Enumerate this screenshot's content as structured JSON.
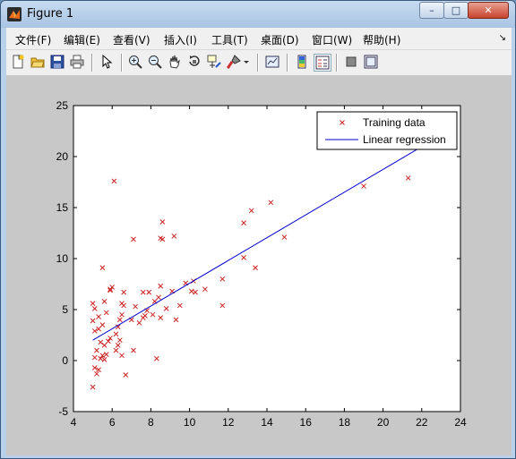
{
  "window": {
    "title": "Figure 1",
    "minimize_label": "–",
    "maximize_label": "□",
    "close_label": "✕"
  },
  "menu": {
    "items": [
      "文件(F)",
      "编辑(E)",
      "查看(V)",
      "插入(I)",
      "工具(T)",
      "桌面(D)",
      "窗口(W)",
      "帮助(H)"
    ],
    "overflow": "↘"
  },
  "toolbar": {
    "icons": [
      "new-figure-icon",
      "open-file-icon",
      "save-icon",
      "print-icon",
      "pointer-icon",
      "zoom-in-icon",
      "zoom-out-icon",
      "pan-icon",
      "rotate-3d-icon",
      "data-cursor-icon",
      "brush-icon",
      "link-plot-icon",
      "colorbar-icon",
      "legend-icon",
      "hide-plot-tools-icon",
      "show-plot-tools-icon"
    ]
  },
  "chart_data": {
    "type": "scatter",
    "xlim": [
      4,
      24
    ],
    "ylim": [
      -5,
      25
    ],
    "xticks": [
      4,
      6,
      8,
      10,
      12,
      14,
      16,
      18,
      20,
      22,
      24
    ],
    "yticks": [
      -5,
      0,
      5,
      10,
      15,
      20,
      25
    ],
    "grid": false,
    "legend_placement": "top-right",
    "legend": {
      "scatter_label": "Training data",
      "line_label": "Linear regression"
    },
    "colors": {
      "scatter": "#cc2222",
      "line": "#0000cc"
    },
    "series": [
      {
        "name": "Training data",
        "marker": "x",
        "points": [
          [
            5.0,
            -2.6
          ],
          [
            5.1,
            -0.7
          ],
          [
            5.2,
            -1.3
          ],
          [
            5.3,
            -0.9
          ],
          [
            5.4,
            0.2
          ],
          [
            5.1,
            0.3
          ],
          [
            5.2,
            1.0
          ],
          [
            5.5,
            0.5
          ],
          [
            5.6,
            0.1
          ],
          [
            5.7,
            0.6
          ],
          [
            5.4,
            1.8
          ],
          [
            5.6,
            1.5
          ],
          [
            5.8,
            1.9
          ],
          [
            5.9,
            2.2
          ],
          [
            5.1,
            2.9
          ],
          [
            5.3,
            3.1
          ],
          [
            5.5,
            3.5
          ],
          [
            5.0,
            3.9
          ],
          [
            5.3,
            4.3
          ],
          [
            5.7,
            4.7
          ],
          [
            5.1,
            5.1
          ],
          [
            5.0,
            5.6
          ],
          [
            5.6,
            5.8
          ],
          [
            5.9,
            7.0
          ],
          [
            5.9,
            6.9
          ],
          [
            6.0,
            7.2
          ],
          [
            5.5,
            9.1
          ],
          [
            6.1,
            17.6
          ],
          [
            6.2,
            1.0
          ],
          [
            6.3,
            1.5
          ],
          [
            6.2,
            2.6
          ],
          [
            6.4,
            2.0
          ],
          [
            6.5,
            0.5
          ],
          [
            6.3,
            3.3
          ],
          [
            6.4,
            4.0
          ],
          [
            6.5,
            4.5
          ],
          [
            6.6,
            5.4
          ],
          [
            6.5,
            5.6
          ],
          [
            6.6,
            6.7
          ],
          [
            6.7,
            -1.4
          ],
          [
            7.0,
            4.0
          ],
          [
            7.1,
            1.0
          ],
          [
            7.2,
            5.3
          ],
          [
            7.4,
            3.7
          ],
          [
            7.6,
            4.2
          ],
          [
            7.7,
            4.4
          ],
          [
            7.6,
            6.7
          ],
          [
            7.8,
            4.9
          ],
          [
            7.9,
            6.7
          ],
          [
            7.1,
            11.9
          ],
          [
            8.1,
            4.5
          ],
          [
            8.2,
            5.8
          ],
          [
            8.4,
            6.2
          ],
          [
            8.5,
            7.3
          ],
          [
            8.3,
            0.2
          ],
          [
            8.5,
            4.2
          ],
          [
            8.6,
            11.9
          ],
          [
            8.5,
            12.0
          ],
          [
            8.6,
            13.6
          ],
          [
            8.8,
            5.1
          ],
          [
            9.1,
            6.8
          ],
          [
            9.3,
            4.0
          ],
          [
            9.2,
            12.2
          ],
          [
            9.5,
            5.4
          ],
          [
            9.8,
            7.6
          ],
          [
            10.1,
            6.8
          ],
          [
            10.2,
            7.8
          ],
          [
            10.3,
            6.7
          ],
          [
            10.8,
            7.0
          ],
          [
            11.7,
            8.0
          ],
          [
            11.7,
            5.4
          ],
          [
            12.8,
            10.1
          ],
          [
            12.8,
            13.5
          ],
          [
            13.2,
            14.7
          ],
          [
            13.4,
            9.1
          ],
          [
            14.2,
            15.5
          ],
          [
            14.9,
            12.1
          ],
          [
            19.0,
            17.1
          ],
          [
            21.3,
            17.9
          ]
        ]
      },
      {
        "name": "Linear regression",
        "type": "line",
        "x": [
          5.0,
          22.2
        ],
        "y": [
          2.0,
          21.2
        ]
      }
    ]
  }
}
